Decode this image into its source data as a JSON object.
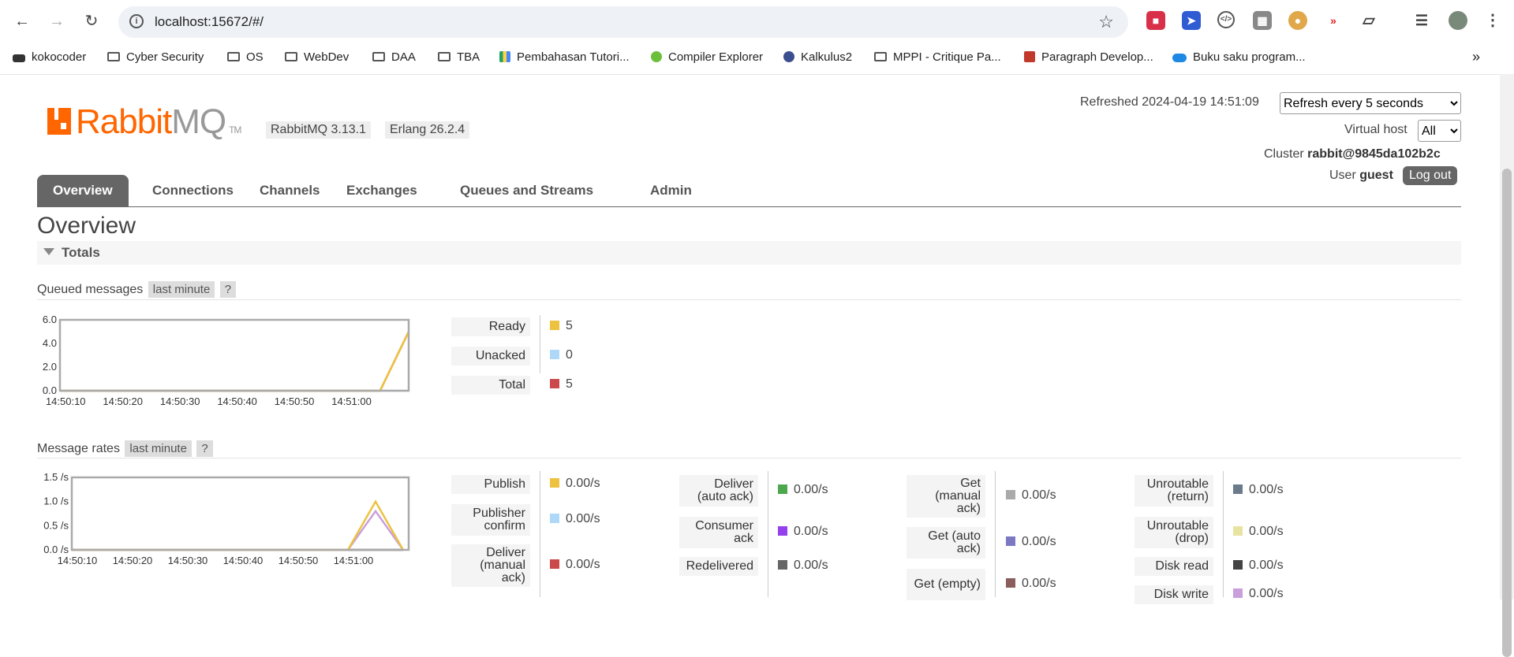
{
  "browser": {
    "url": "localhost:15672/#/",
    "bookmarks": [
      "kokocoder",
      "Cyber Security",
      "OS",
      "WebDev",
      "DAA",
      "TBA",
      "Pembahasan Tutori...",
      "Compiler Explorer",
      "Kalkulus2",
      "MPPI - Critique Pa...",
      "Paragraph Develop...",
      "Buku saku program..."
    ]
  },
  "header": {
    "logo_rabbit": "Rabbit",
    "logo_mq": "MQ",
    "logo_tm": "TM",
    "version": "RabbitMQ 3.13.1",
    "erlang": "Erlang 26.2.4",
    "refreshed_label": "Refreshed",
    "refreshed_time": "2024-04-19 14:51:09",
    "refresh_option": "Refresh every 5 seconds",
    "vhost_label": "Virtual host",
    "vhost_value": "All",
    "cluster_label": "Cluster",
    "cluster_value": "rabbit@9845da102b2c",
    "user_label": "User",
    "user_value": "guest",
    "logout": "Log out"
  },
  "tabs": [
    "Overview",
    "Connections",
    "Channels",
    "Exchanges",
    "Queues and Streams",
    "Admin"
  ],
  "page_title": "Overview",
  "totals_label": "Totals",
  "queued": {
    "title": "Queued messages",
    "period": "last minute",
    "help": "?",
    "legend": [
      {
        "label": "Ready",
        "value": "5",
        "color": "#edc240"
      },
      {
        "label": "Unacked",
        "value": "0",
        "color": "#afd8f8"
      },
      {
        "label": "Total",
        "value": "5",
        "color": "#cb4b4b"
      }
    ]
  },
  "rates": {
    "title": "Message rates",
    "period": "last minute",
    "help": "?",
    "col1": [
      {
        "label": "Publish",
        "value": "0.00/s",
        "color": "#edc240"
      },
      {
        "label": "Publisher confirm",
        "value": "0.00/s",
        "color": "#afd8f8"
      },
      {
        "label": "Deliver (manual ack)",
        "value": "0.00/s",
        "color": "#cb4b4b"
      }
    ],
    "col2": [
      {
        "label": "Deliver (auto ack)",
        "value": "0.00/s",
        "color": "#4da74d"
      },
      {
        "label": "Consumer ack",
        "value": "0.00/s",
        "color": "#9440ed"
      },
      {
        "label": "Redelivered",
        "value": "0.00/s",
        "color": "#666666"
      }
    ],
    "col3": [
      {
        "label": "Get (manual ack)",
        "value": "0.00/s",
        "color": "#aaaaaa"
      },
      {
        "label": "Get (auto ack)",
        "value": "0.00/s",
        "color": "#7c79c3"
      },
      {
        "label": "Get (empty)",
        "value": "0.00/s",
        "color": "#8b5e5e"
      }
    ],
    "col4": [
      {
        "label": "Unroutable (return)",
        "value": "0.00/s",
        "color": "#6b7b8b"
      },
      {
        "label": "Unroutable (drop)",
        "value": "0.00/s",
        "color": "#e8e3a1"
      },
      {
        "label": "Disk read",
        "value": "0.00/s",
        "color": "#444444"
      },
      {
        "label": "Disk write",
        "value": "0.00/s",
        "color": "#c9a0dc"
      }
    ]
  },
  "chart_data": [
    {
      "type": "line",
      "x": [
        "14:50:10",
        "14:50:20",
        "14:50:30",
        "14:50:40",
        "14:50:50",
        "14:51:00"
      ],
      "yticks": [
        "0.0",
        "2.0",
        "4.0",
        "6.0"
      ],
      "ylim": [
        0,
        6
      ],
      "series": [
        {
          "name": "Ready",
          "color": "#edc240",
          "points": [
            [
              0,
              0
            ],
            [
              50,
              0
            ],
            [
              56,
              0
            ],
            [
              61,
              5
            ]
          ]
        },
        {
          "name": "Unacked",
          "color": "#afd8f8",
          "points": [
            [
              0,
              0
            ],
            [
              61,
              0
            ]
          ]
        },
        {
          "name": "Total",
          "color": "#cb4b4b",
          "points": [
            [
              0,
              0
            ],
            [
              50,
              0
            ],
            [
              56,
              0
            ],
            [
              61,
              5
            ]
          ]
        }
      ]
    },
    {
      "type": "line",
      "x": [
        "14:50:10",
        "14:50:20",
        "14:50:30",
        "14:50:40",
        "14:50:50",
        "14:51:00"
      ],
      "yticks": [
        "0.0 /s",
        "0.5 /s",
        "1.0 /s",
        "1.5 /s"
      ],
      "ylim": [
        0,
        1.5
      ],
      "series": [
        {
          "name": "Publish",
          "color": "#edc240",
          "points": [
            [
              0,
              0
            ],
            [
              50,
              0
            ],
            [
              55,
              1.0
            ],
            [
              60,
              0
            ]
          ]
        },
        {
          "name": "Consumer ack",
          "color": "#c9a0dc",
          "points": [
            [
              0,
              0
            ],
            [
              50,
              0
            ],
            [
              55,
              0.8
            ],
            [
              60,
              0
            ]
          ]
        },
        {
          "name": "Deliver (manual ack)",
          "color": "#444444",
          "points": [
            [
              0,
              0
            ],
            [
              60,
              0
            ]
          ]
        }
      ]
    }
  ]
}
